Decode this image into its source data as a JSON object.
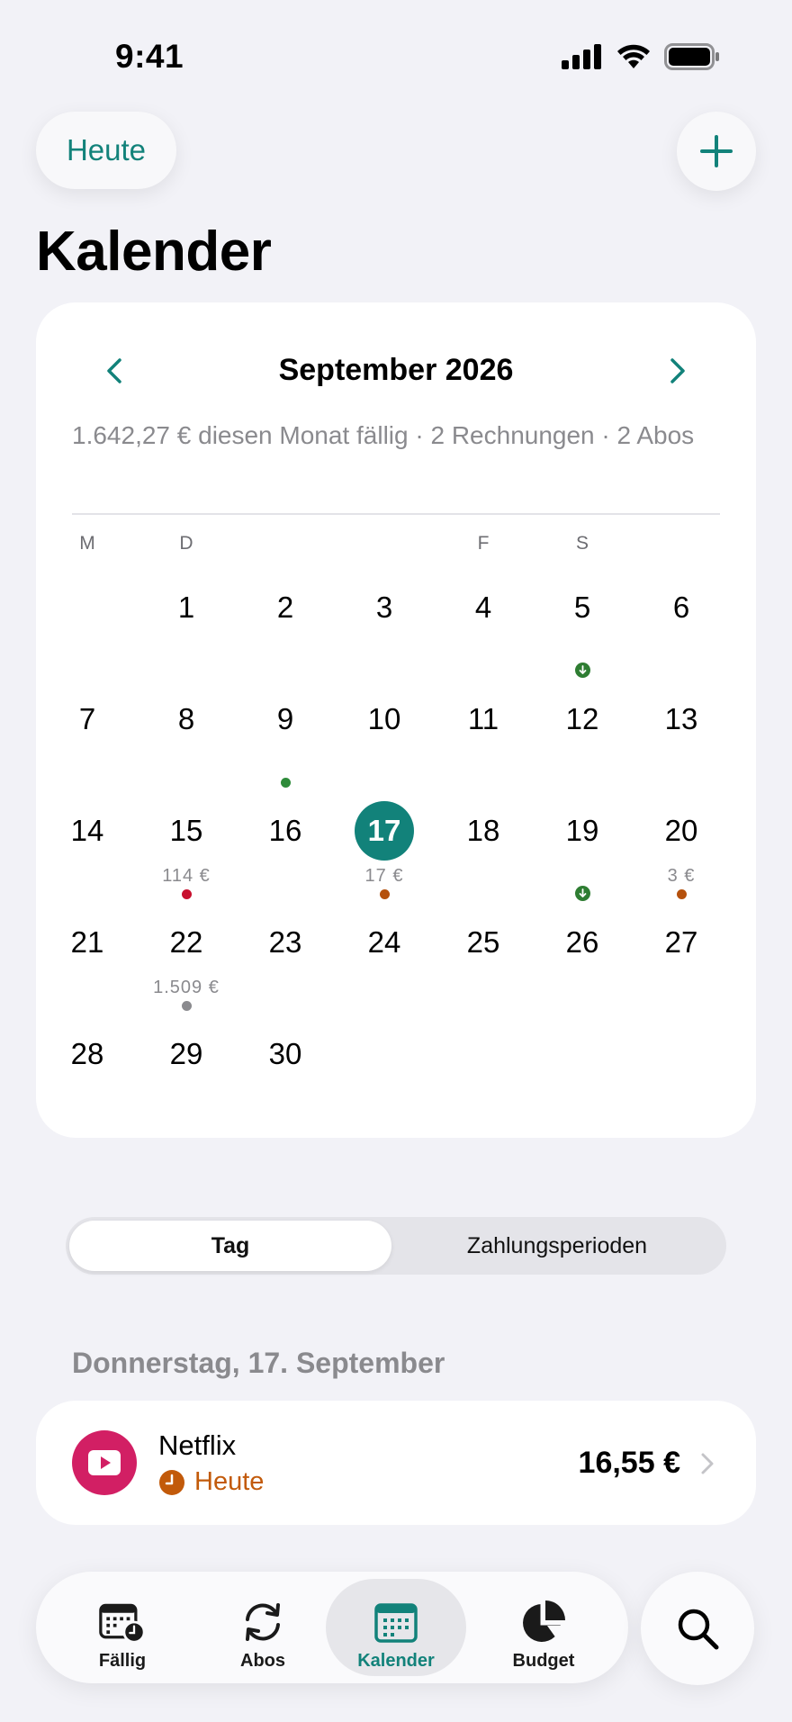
{
  "status_bar": {
    "time": "9:41"
  },
  "header": {
    "today_label": "Heute",
    "title": "Kalender"
  },
  "calendar": {
    "month_label": "September 2026",
    "summary": "1.642,27 € diesen Monat fällig · 2 Rechnungen · 2 Abos",
    "weekdays": [
      "M",
      "D",
      "",
      "",
      "F",
      "S",
      ""
    ],
    "days": [
      {
        "n": "1"
      },
      {
        "n": "2"
      },
      {
        "n": "3"
      },
      {
        "n": "4"
      },
      {
        "n": "5",
        "dot": "arrow"
      },
      {
        "n": "6"
      },
      {
        "n": "7"
      },
      {
        "n": "8"
      },
      {
        "n": "9",
        "dot": "green"
      },
      {
        "n": "10"
      },
      {
        "n": "11"
      },
      {
        "n": "12"
      },
      {
        "n": "13"
      },
      {
        "n": "14"
      },
      {
        "n": "15",
        "amount": "114 €",
        "dot": "red"
      },
      {
        "n": "16"
      },
      {
        "n": "17",
        "amount": "17 €",
        "dot": "orange",
        "selected": true
      },
      {
        "n": "18"
      },
      {
        "n": "19",
        "dot": "arrow"
      },
      {
        "n": "20",
        "amount": "3 €",
        "dot": "orange"
      },
      {
        "n": "21"
      },
      {
        "n": "22",
        "amount": "1.509 €",
        "dot": "gray"
      },
      {
        "n": "23"
      },
      {
        "n": "24"
      },
      {
        "n": "25"
      },
      {
        "n": "26"
      },
      {
        "n": "27"
      },
      {
        "n": "28"
      },
      {
        "n": "29"
      },
      {
        "n": "30"
      }
    ],
    "first_weekday_offset": 1,
    "dot_colors": {
      "green": "#2e8b3a",
      "red": "#c8102e",
      "orange": "#b5510d",
      "gray": "#8a8a8e",
      "arrow": "#2e7d32"
    }
  },
  "segmented": {
    "tab_day": "Tag",
    "tab_periods": "Zahlungsperioden"
  },
  "day_section": {
    "title": "Donnerstag, 17. September",
    "items": [
      {
        "name": "Netflix",
        "status": "Heute",
        "amount": "16,55 €",
        "icon": "play-icon",
        "brand_color": "#d21f64"
      }
    ]
  },
  "tabbar": {
    "tabs": [
      {
        "label": "Fällig",
        "icon": "calendar-clock-icon"
      },
      {
        "label": "Abos",
        "icon": "refresh-icon"
      },
      {
        "label": "Kalender",
        "icon": "calendar-grid-icon",
        "active": true
      },
      {
        "label": "Budget",
        "icon": "pie-chart-icon"
      }
    ],
    "search_icon": "search-icon"
  },
  "colors": {
    "accent": "#12827a",
    "background": "#f2f2f7",
    "status_orange": "#c25a0a"
  }
}
